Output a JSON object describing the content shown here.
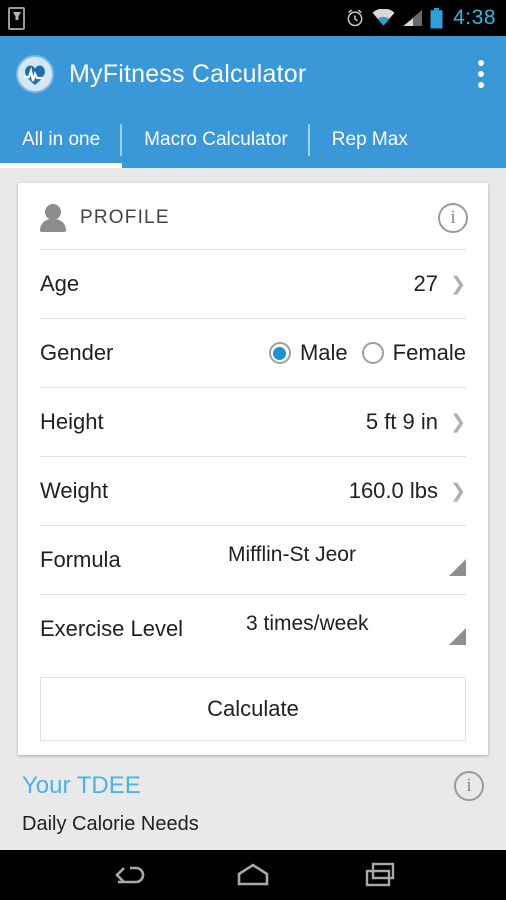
{
  "status_bar": {
    "download_icon": "download-to-device-icon",
    "alarm_icon": "alarm-clock-icon",
    "wifi_icon": "wifi-icon",
    "signal_icon": "cellular-signal-icon",
    "battery_icon": "battery-icon",
    "time": "4:38",
    "accent_color": "#33b5e5"
  },
  "action_bar": {
    "logo": "app-logo-heart-icon",
    "title": "MyFitness Calculator",
    "overflow": "overflow-menu-icon",
    "background_color": "#3a98d8"
  },
  "tabs": [
    {
      "label": "All in one",
      "active": true
    },
    {
      "label": "Macro Calculator",
      "active": false
    },
    {
      "label": "Rep Max",
      "active": false
    }
  ],
  "profile_card": {
    "icon": "person-icon",
    "title": "PROFILE",
    "info_icon": "info-icon",
    "rows": [
      {
        "label": "Age",
        "value": "27",
        "type": "chevron"
      },
      {
        "label": "Gender",
        "type": "radio"
      },
      {
        "label": "Height",
        "value": "5 ft 9 in",
        "type": "chevron"
      },
      {
        "label": "Weight",
        "value": "160.0 lbs",
        "type": "chevron"
      },
      {
        "label": "Formula",
        "value": "Mifflin-St Jeor",
        "type": "spinner"
      },
      {
        "label": "Exercise Level",
        "value": "3 times/week",
        "type": "spinner"
      }
    ],
    "gender": {
      "selected": "Male",
      "options": [
        {
          "label": "Male",
          "checked": true
        },
        {
          "label": "Female",
          "checked": false
        }
      ],
      "selected_color": "#1a92d0"
    },
    "calculate_label": "Calculate"
  },
  "tdee_section": {
    "title": "Your TDEE",
    "subtitle": "Daily Calorie Needs",
    "info_icon": "info-icon",
    "title_color": "#4ab4e8"
  },
  "nav_bar": {
    "back": "back-icon",
    "home": "home-icon",
    "recents": "recent-apps-icon"
  }
}
